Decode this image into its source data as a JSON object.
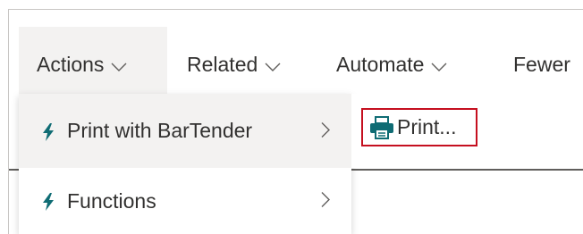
{
  "action_bar": {
    "tabs": [
      {
        "label": "Actions",
        "icon": "chevron-down-icon"
      },
      {
        "label": "Related",
        "icon": "chevron-down-icon"
      },
      {
        "label": "Automate",
        "icon": "chevron-down-icon"
      },
      {
        "label": "Fewer"
      }
    ]
  },
  "menu": {
    "items": [
      {
        "label": "Print with BarTender",
        "icon": "lightning-bolt-icon",
        "selected": true
      },
      {
        "label": "Functions",
        "icon": "lightning-bolt-icon",
        "selected": false
      }
    ]
  },
  "submenu": {
    "print_label": "Print...",
    "print_icon": "printer-icon",
    "highlight_color": "#c50f1f"
  },
  "colors": {
    "accent_teal": "#0f6c74",
    "hover_bg": "#f3f2f1"
  }
}
